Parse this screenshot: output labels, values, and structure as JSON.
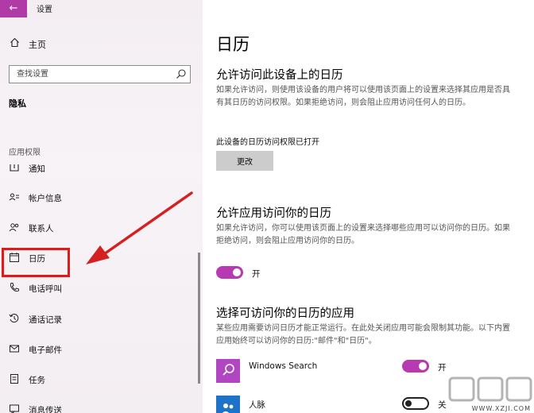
{
  "window": {
    "title": "设置",
    "back_glyph": "←"
  },
  "sidebar": {
    "home_label": "主页",
    "search_placeholder": "查找设置",
    "section_title": "隐私",
    "group_label": "应用权限",
    "items": [
      {
        "label": "通知",
        "icon": "notification-icon"
      },
      {
        "label": "帐户信息",
        "icon": "account-info-icon"
      },
      {
        "label": "联系人",
        "icon": "contacts-icon"
      },
      {
        "label": "日历",
        "icon": "calendar-icon",
        "selected": true
      },
      {
        "label": "电话呼叫",
        "icon": "phone-icon"
      },
      {
        "label": "通话记录",
        "icon": "call-history-icon"
      },
      {
        "label": "电子邮件",
        "icon": "email-icon"
      },
      {
        "label": "任务",
        "icon": "tasks-icon"
      },
      {
        "label": "消息传送",
        "icon": "messaging-icon"
      }
    ]
  },
  "main": {
    "page_title": "日历",
    "device_section": {
      "heading": "允许访问此设备上的日历",
      "description": "如果允许访问，则使用该设备的用户将可以使用该页面上的设置来选择其应用是否具有其日历的访问权限。如果拒绝访问，则会阻止应用访问任何人的日历。",
      "status": "此设备的日历访问权限已打开",
      "change_button": "更改"
    },
    "app_access_section": {
      "heading": "允许应用访问你的日历",
      "description": "如果允许访问，你可以使用该页面上的设置来选择哪些应用可以访问你的日历。如果拒绝访问，则会阻止应用访问你的日历。",
      "toggle_state": "开",
      "toggle_on": true
    },
    "choose_apps_section": {
      "heading": "选择可访问你的日历的应用",
      "description": "某些应用需要访问日历才能正常运行。在此处关闭应用可能会限制其功能。以下内置应用始终可以访问你的日历:\"邮件\"和\"日历\"。",
      "apps": [
        {
          "name": "Windows Search",
          "toggle_label": "开",
          "on": true,
          "tile_color": "#b146c2",
          "icon": "search-app-icon"
        },
        {
          "name": "人脉",
          "toggle_label": "关",
          "on": false,
          "tile_color": "#1e73c8",
          "icon": "people-app-icon"
        }
      ]
    }
  },
  "colors": {
    "accent": "#b83ab2",
    "highlight_box": "#e31818",
    "arrow": "#d42020"
  },
  "watermark": {
    "text": "WWW.XZJI.COM"
  }
}
